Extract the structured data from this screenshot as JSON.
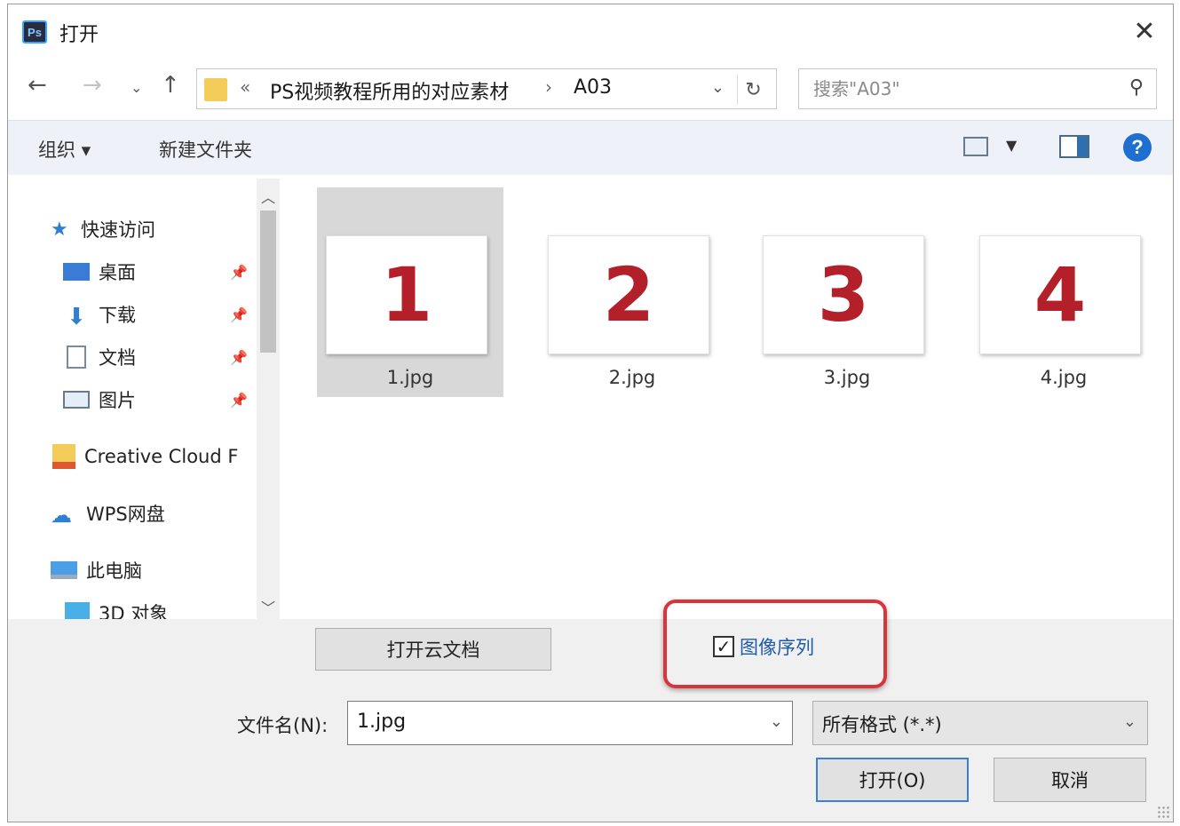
{
  "window": {
    "title": "打开",
    "app_badge": "Ps"
  },
  "address": {
    "overflow": "«",
    "crumbs": [
      "PS视频教程所用的对应素材",
      "A03"
    ],
    "separator": "›"
  },
  "search": {
    "placeholder": "搜索\"A03\""
  },
  "toolbar": {
    "organize": "组织 ▾",
    "new_folder": "新建文件夹"
  },
  "sidebar": {
    "items": [
      {
        "label": "快速访问",
        "icon": "star-icon",
        "pinned": false
      },
      {
        "label": "桌面",
        "icon": "desktop-icon",
        "pinned": true
      },
      {
        "label": "下载",
        "icon": "download-icon",
        "pinned": true
      },
      {
        "label": "文档",
        "icon": "document-icon",
        "pinned": true
      },
      {
        "label": "图片",
        "icon": "pictures-icon",
        "pinned": true
      },
      {
        "label": "Creative Cloud F",
        "icon": "creative-cloud-icon",
        "pinned": false
      },
      {
        "label": "WPS网盘",
        "icon": "cloud-icon",
        "pinned": false
      },
      {
        "label": "此电脑",
        "icon": "computer-icon",
        "pinned": false
      },
      {
        "label": "3D 对象",
        "icon": "3d-objects-icon",
        "pinned": false
      }
    ]
  },
  "files": [
    {
      "name": "1.jpg",
      "preview": "1",
      "selected": true
    },
    {
      "name": "2.jpg",
      "preview": "2",
      "selected": false
    },
    {
      "name": "3.jpg",
      "preview": "3",
      "selected": false
    },
    {
      "name": "4.jpg",
      "preview": "4",
      "selected": false
    }
  ],
  "bottom": {
    "open_cloud_doc": "打开云文档",
    "image_sequence": {
      "label": "图像序列",
      "checked": true,
      "check_mark": "✓"
    },
    "filename_label": "文件名(N):",
    "filename_value": "1.jpg",
    "filter_value": "所有格式 (*.*)",
    "open_button": "打开(O)",
    "cancel_button": "取消"
  },
  "colors": {
    "accent": "#1f5ba8",
    "highlight": "#d9343c",
    "thumb_digit": "#b3202a"
  }
}
